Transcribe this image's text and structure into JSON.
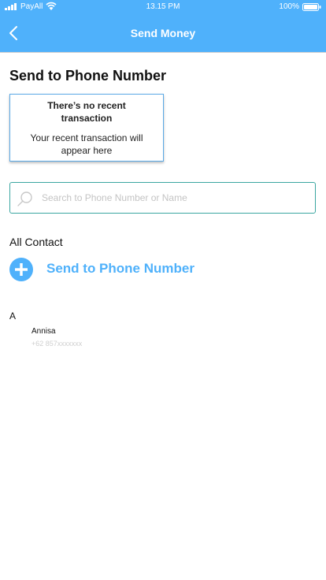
{
  "status_bar": {
    "carrier": "PayAll",
    "time": "13.15 PM",
    "battery": "100%"
  },
  "header": {
    "title": "Send Money",
    "back_icon": "chevron-left-icon"
  },
  "page_title": "Send to Phone Number",
  "recent_card": {
    "title": "There’s no recent transaction",
    "subtitle": "Your recent transaction will appear here"
  },
  "search": {
    "placeholder": "Search to Phone Number or Name",
    "value": ""
  },
  "contacts": {
    "section_label": "All Contact",
    "send_phone_label": "Send to Phone Number",
    "groups": [
      {
        "letter": "A",
        "items": [
          {
            "name": "Annisa",
            "phone": "+62 857xxxxxxx"
          }
        ]
      }
    ]
  },
  "colors": {
    "primary": "#4fb1fb",
    "search_border": "#3aa6a0",
    "card_border": "#5aa9e6",
    "muted_text": "#cfcfcf"
  }
}
